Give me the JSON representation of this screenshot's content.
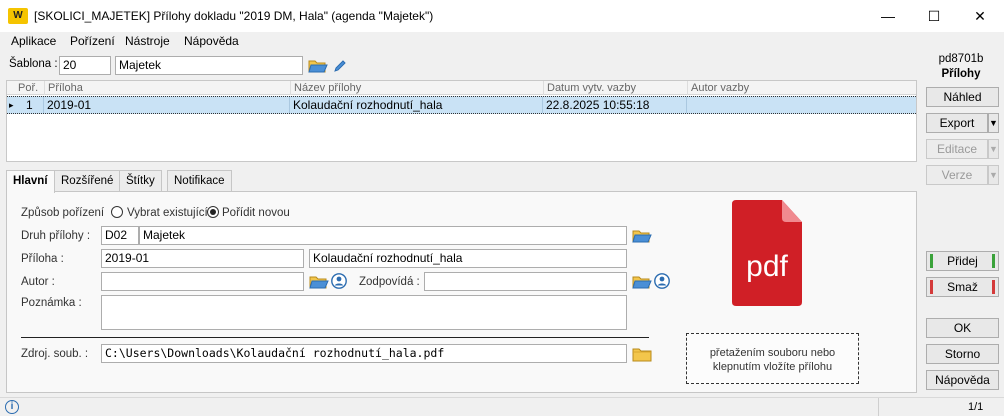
{
  "window": {
    "title": "[SKOLICI_MAJETEK] Přílohy dokladu \"2019 DM, Hala\" (agenda \"Majetek\")",
    "logo": "W",
    "minimize_icon": "—",
    "maximize_icon": "☐",
    "close_icon": "✕"
  },
  "menu": [
    "Aplikace",
    "Pořízení",
    "Nástroje",
    "Nápověda"
  ],
  "template": {
    "label": "Šablona :",
    "code": "20",
    "name": "Majetek"
  },
  "grid": {
    "columns": [
      "Poř.",
      "Příloha",
      "Název přílohy",
      "Datum vytv. vazby",
      "Autor vazby"
    ],
    "rows": [
      {
        "marker": "▸",
        "order": "1",
        "attachment": "2019-01",
        "name": "Kolaudační rozhodnutí_hala",
        "date": "22.8.2025 10:55:18",
        "author": ""
      }
    ]
  },
  "tabs": [
    "Hlavní",
    "Rozšířené",
    "Štítky",
    "Notifikace"
  ],
  "form": {
    "acq_label": "Způsob pořízení",
    "radio_existing": "Vybrat existující",
    "radio_new": "Pořídit novou",
    "type_label": "Druh přílohy :",
    "type_code": "D02",
    "type_name": "Majetek",
    "attachment_label": "Příloha :",
    "attachment_code": "2019-01",
    "attachment_name": "Kolaudační rozhodnutí_hala",
    "author_label": "Autor :",
    "author_value": "",
    "responsible_label": "Zodpovídá :",
    "responsible_value": "",
    "note_label": "Poznámka :",
    "note_value": "",
    "source_label": "Zdroj. soub. :",
    "source_value": "C:\\Users\\Downloads\\Kolaudační rozhodnutí_hala.pdf"
  },
  "pdf_icon_text": "pdf",
  "dropzone": {
    "line1": "přetažením souboru nebo",
    "line2": "klepnutím vložíte přílohu"
  },
  "right_panel": {
    "form_id": "pd8701b",
    "form_title": "Přílohy",
    "btn_preview": "Náhled",
    "btn_export": "Export",
    "btn_edit": "Editace",
    "btn_version": "Verze",
    "btn_add": "Přidej",
    "btn_delete": "Smaž",
    "btn_ok": "OK",
    "btn_cancel": "Storno",
    "btn_help": "Nápověda",
    "arrow": "▼"
  },
  "status": {
    "info_icon": "i",
    "page": "1/1"
  },
  "colors": {
    "selection": "#c9e2f5",
    "pdf_red": "#d01f26",
    "add_green": "#3aa23a",
    "delete_red": "#d43a3a",
    "logo_yellow": "#f5c400"
  }
}
